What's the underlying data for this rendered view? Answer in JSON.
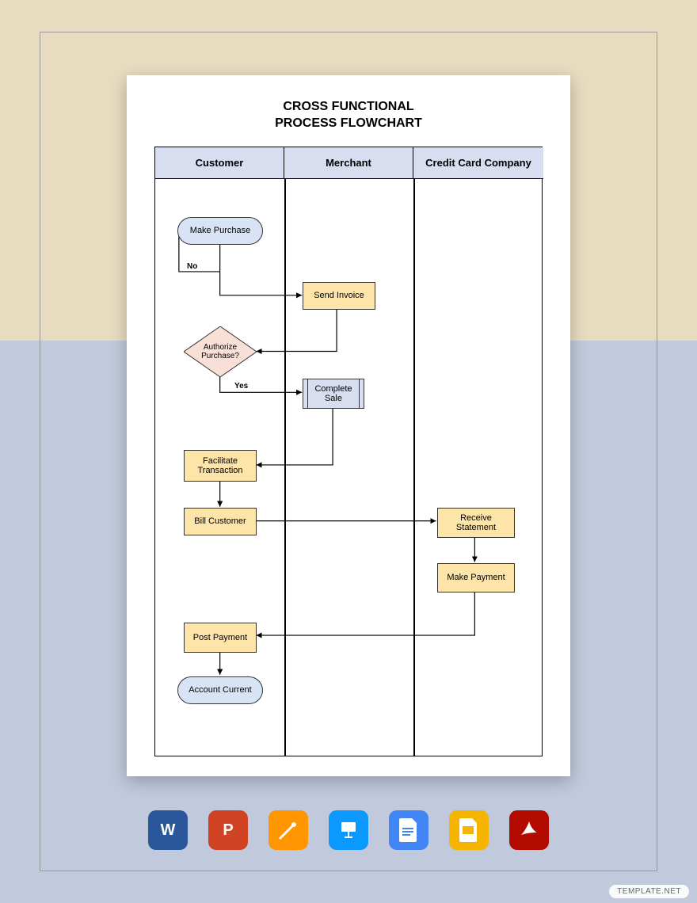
{
  "title": "CROSS FUNCTIONAL\nPROCESS FLOWCHART",
  "lanes": [
    "Customer",
    "Merchant",
    "Credit Card Company"
  ],
  "nodes": {
    "make_purchase": "Make Purchase",
    "send_invoice": "Send Invoice",
    "authorize": "Authorize\nPurchase?",
    "complete_sale": "Complete\nSale",
    "facilitate": "Facilitate\nTransaction",
    "bill_customer": "Bill Customer",
    "receive_stmt": "Receive\nStatement",
    "make_payment": "Make Payment",
    "post_payment": "Post Payment",
    "account_current": "Account Current"
  },
  "labels": {
    "no": "No",
    "yes": "Yes"
  },
  "icons": [
    "word",
    "powerpoint",
    "pages",
    "keynote",
    "google-docs",
    "google-slides",
    "pdf"
  ],
  "watermark": "TEMPLATE.NET",
  "colors": {
    "bg_top": "#e8dcc0",
    "bg_bottom": "#c1c9dc",
    "lane_header": "#d8def0",
    "process": "#fde4a8",
    "terminator": "#d8e4f5",
    "decision": "#f8e0d6"
  }
}
